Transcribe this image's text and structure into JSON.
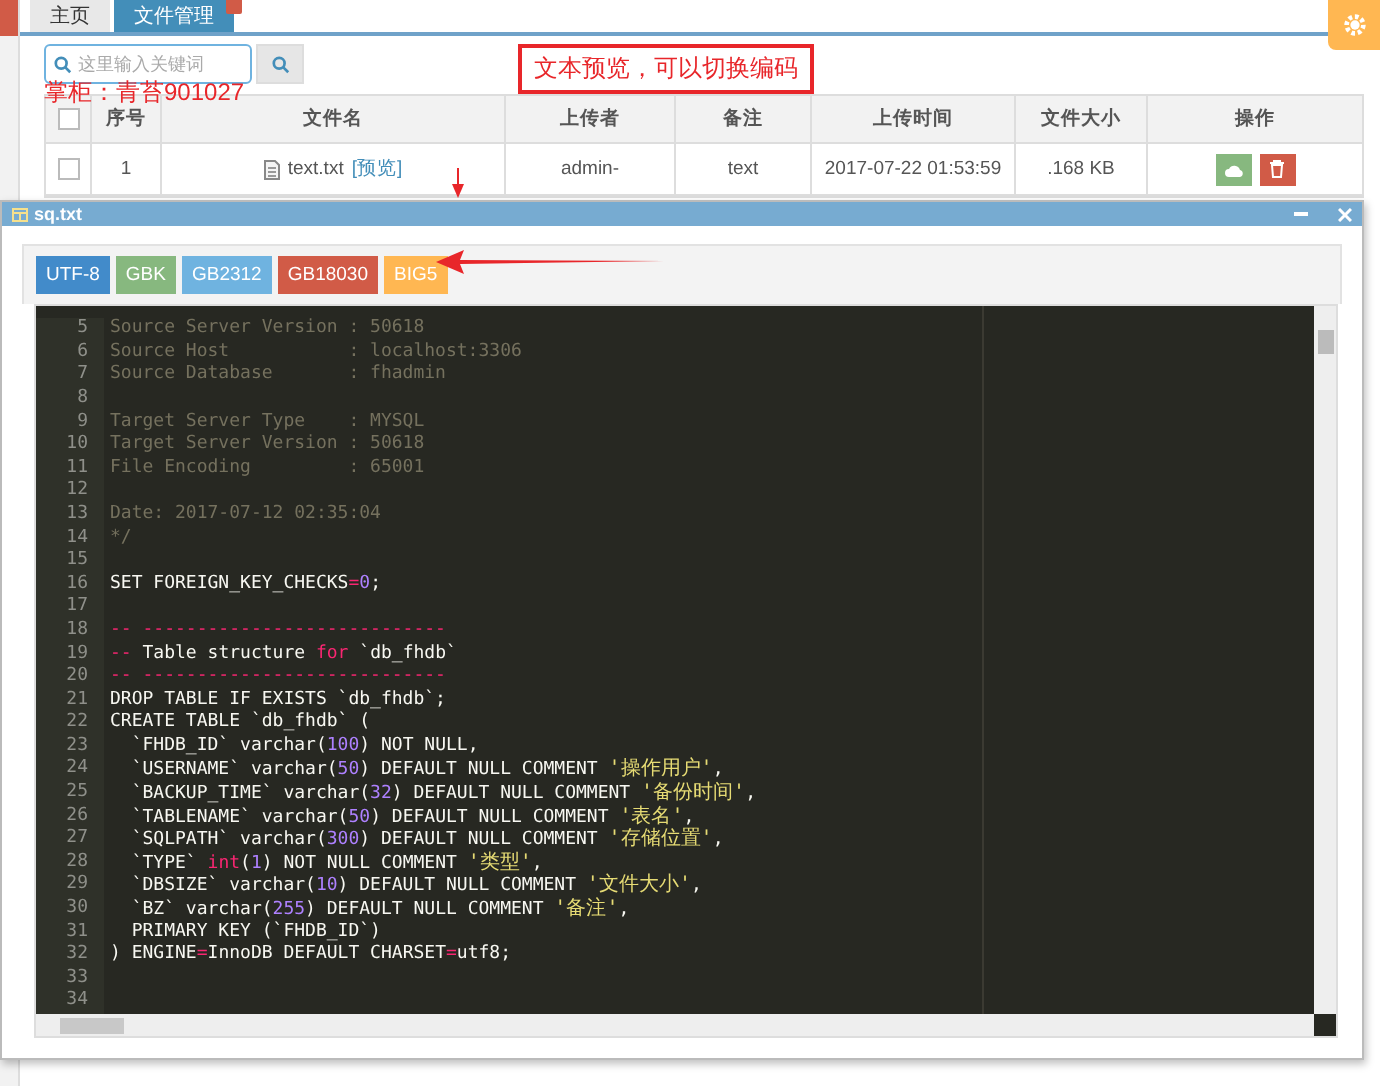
{
  "tabs": [
    {
      "label": "主页",
      "selected": false,
      "closable": false
    },
    {
      "label": "文件管理",
      "selected": true,
      "closable": true
    }
  ],
  "search": {
    "placeholder": "这里输入关键词"
  },
  "annotations": [
    "文本预览，可以切换编码",
    "掌柜：青苔901027"
  ],
  "table": {
    "header_checked": false,
    "columns": [
      "序号",
      "文件名",
      "上传者",
      "备注",
      "上传时间",
      "文件大小",
      "操作"
    ],
    "rows": [
      {
        "checked": false,
        "index": "1",
        "file": "text.txt",
        "preview_link": "[预览]",
        "uploader": "admin-",
        "note": "text",
        "time": "2017-07-22 01:53:59",
        "size": ".168 KB"
      }
    ]
  },
  "dialog": {
    "title": "sq.txt",
    "encodings": [
      {
        "label": "UTF-8",
        "color": "#428bca"
      },
      {
        "label": "GBK",
        "color": "#87b87f"
      },
      {
        "label": "GB2312",
        "color": "#6fb3e0"
      },
      {
        "label": "GB18030",
        "color": "#d15b47"
      },
      {
        "label": "BIG5",
        "color": "#ffb752"
      }
    ],
    "code": [
      {
        "n": "5",
        "tokens": [
          {
            "kind": "comment",
            "text": "Source Server Version : 50618"
          }
        ]
      },
      {
        "n": "6",
        "tokens": [
          {
            "kind": "comment",
            "text": "Source Host           : localhost:3306"
          }
        ]
      },
      {
        "n": "7",
        "tokens": [
          {
            "kind": "comment",
            "text": "Source Database       : fhadmin"
          }
        ]
      },
      {
        "n": "8"
      },
      {
        "n": "9",
        "tokens": [
          {
            "kind": "comment",
            "text": "Target Server Type    : MYSQL"
          }
        ]
      },
      {
        "n": "10",
        "tokens": [
          {
            "kind": "comment",
            "text": "Target Server Version : 50618"
          }
        ]
      },
      {
        "n": "11",
        "tokens": [
          {
            "kind": "comment",
            "text": "File Encoding         : 65001"
          }
        ]
      },
      {
        "n": "12"
      },
      {
        "n": "13",
        "tokens": [
          {
            "kind": "comment",
            "text": "Date: 2017-07-12 02:35:04"
          }
        ]
      },
      {
        "n": "14",
        "tokens": [
          {
            "kind": "comment",
            "text": "*/"
          }
        ]
      },
      {
        "n": "15"
      },
      {
        "n": "16",
        "tokens": [
          {
            "kind": "plain",
            "text": "SET FOREIGN_KEY_CHECKS"
          },
          {
            "kind": "keyword",
            "text": "="
          },
          {
            "kind": "number",
            "text": "0"
          },
          {
            "kind": "plain",
            "text": ";"
          }
        ]
      },
      {
        "n": "17"
      },
      {
        "n": "18",
        "tokens": [
          {
            "kind": "dash",
            "text": "-- ----------------------------"
          }
        ]
      },
      {
        "n": "19",
        "tokens": [
          {
            "kind": "dash",
            "text": "--"
          },
          {
            "kind": "plain",
            "text": " Table structure "
          },
          {
            "kind": "keyword",
            "text": "for"
          },
          {
            "kind": "plain",
            "text": " `db_fhdb`"
          }
        ]
      },
      {
        "n": "20",
        "tokens": [
          {
            "kind": "dash",
            "text": "-- ----------------------------"
          }
        ]
      },
      {
        "n": "21",
        "tokens": [
          {
            "kind": "plain",
            "text": "DROP TABLE IF EXISTS `db_fhdb`;"
          }
        ]
      },
      {
        "n": "22",
        "tokens": [
          {
            "kind": "plain",
            "text": "CREATE TABLE `db_fhdb` ("
          }
        ]
      },
      {
        "n": "23",
        "tokens": [
          {
            "kind": "plain",
            "text": "  `FHDB_ID` varchar("
          },
          {
            "kind": "number",
            "text": "100"
          },
          {
            "kind": "plain",
            "text": ") NOT NULL,"
          }
        ]
      },
      {
        "n": "24",
        "tokens": [
          {
            "kind": "plain",
            "text": "  `USERNAME` varchar("
          },
          {
            "kind": "number",
            "text": "50"
          },
          {
            "kind": "plain",
            "text": ") DEFAULT NULL COMMENT "
          },
          {
            "kind": "string",
            "text": "'操作用户'"
          },
          {
            "kind": "plain",
            "text": ","
          }
        ]
      },
      {
        "n": "25",
        "tokens": [
          {
            "kind": "plain",
            "text": "  `BACKUP_TIME` varchar("
          },
          {
            "kind": "number",
            "text": "32"
          },
          {
            "kind": "plain",
            "text": ") DEFAULT NULL COMMENT "
          },
          {
            "kind": "string",
            "text": "'备份时间'"
          },
          {
            "kind": "plain",
            "text": ","
          }
        ]
      },
      {
        "n": "26",
        "tokens": [
          {
            "kind": "plain",
            "text": "  `TABLENAME` varchar("
          },
          {
            "kind": "number",
            "text": "50"
          },
          {
            "kind": "plain",
            "text": ") DEFAULT NULL COMMENT "
          },
          {
            "kind": "string",
            "text": "'表名'"
          },
          {
            "kind": "plain",
            "text": ","
          }
        ]
      },
      {
        "n": "27",
        "tokens": [
          {
            "kind": "plain",
            "text": "  `SQLPATH` varchar("
          },
          {
            "kind": "number",
            "text": "300"
          },
          {
            "kind": "plain",
            "text": ") DEFAULT NULL COMMENT "
          },
          {
            "kind": "string",
            "text": "'存储位置'"
          },
          {
            "kind": "plain",
            "text": ","
          }
        ]
      },
      {
        "n": "28",
        "tokens": [
          {
            "kind": "plain",
            "text": "  `TYPE` "
          },
          {
            "kind": "keyword",
            "text": "int"
          },
          {
            "kind": "plain",
            "text": "("
          },
          {
            "kind": "number",
            "text": "1"
          },
          {
            "kind": "plain",
            "text": ") NOT NULL COMMENT "
          },
          {
            "kind": "string",
            "text": "'类型'"
          },
          {
            "kind": "plain",
            "text": ","
          }
        ]
      },
      {
        "n": "29",
        "tokens": [
          {
            "kind": "plain",
            "text": "  `DBSIZE` varchar("
          },
          {
            "kind": "number",
            "text": "10"
          },
          {
            "kind": "plain",
            "text": ") DEFAULT NULL COMMENT "
          },
          {
            "kind": "string",
            "text": "'文件大小'"
          },
          {
            "kind": "plain",
            "text": ","
          }
        ]
      },
      {
        "n": "30",
        "tokens": [
          {
            "kind": "plain",
            "text": "  `BZ` varchar("
          },
          {
            "kind": "number",
            "text": "255"
          },
          {
            "kind": "plain",
            "text": ") DEFAULT NULL COMMENT "
          },
          {
            "kind": "string",
            "text": "'备注'"
          },
          {
            "kind": "plain",
            "text": ","
          }
        ]
      },
      {
        "n": "31",
        "tokens": [
          {
            "kind": "plain",
            "text": "  PRIMARY KEY (`FHDB_ID`)"
          }
        ]
      },
      {
        "n": "32",
        "tokens": [
          {
            "kind": "plain",
            "text": ") ENGINE"
          },
          {
            "kind": "keyword",
            "text": "="
          },
          {
            "kind": "plain",
            "text": "InnoDB DEFAULT CHARSET"
          },
          {
            "kind": "keyword",
            "text": "="
          },
          {
            "kind": "plain",
            "text": "utf8;"
          }
        ]
      },
      {
        "n": "33"
      },
      {
        "n": "34"
      }
    ]
  }
}
